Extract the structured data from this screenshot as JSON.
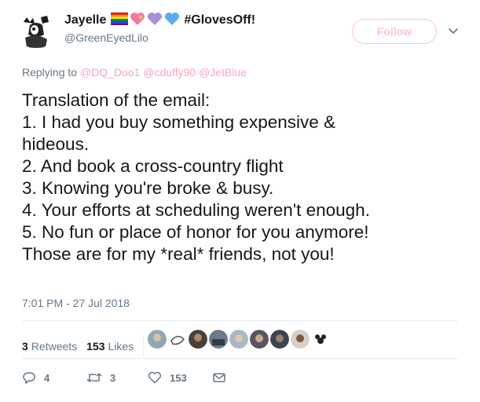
{
  "author": {
    "display_name": "Jayelle",
    "emoji_icons": [
      "rainbow-flag-icon",
      "sparkling-heart-icon",
      "purple-heart-icon",
      "blue-heart-icon"
    ],
    "hashtag": "#GlovesOff!",
    "handle": "@GreenEyedLilo"
  },
  "follow_label": "Follow",
  "reply": {
    "prefix": "Replying to",
    "mentions": [
      "@DQ_Doo1",
      "@cduffy90",
      "@JetBlue"
    ]
  },
  "tweet_lines": [
    "Translation of the email:",
    "1. I had you buy something expensive &",
    "hideous.",
    "2. And book a cross-country flight",
    "3. Knowing you're broke & busy.",
    "4. Your efforts at scheduling weren't enough.",
    "5. No fun or place of honor for you anymore!",
    "Those are for my *real* friends, not you!"
  ],
  "timestamp": "7:01 PM - 27 Jul 2018",
  "stats": {
    "retweets_count": "3",
    "retweets_label": "Retweets",
    "likes_count": "153",
    "likes_label": "Likes"
  },
  "actions": {
    "reply_count": "4",
    "retweet_count": "3",
    "like_count": "153"
  },
  "colors": {
    "follow_accent": "#fbc7d4",
    "mention": "#f6a8b8",
    "secondary_text": "#657786",
    "divider": "#e6ecf0"
  }
}
